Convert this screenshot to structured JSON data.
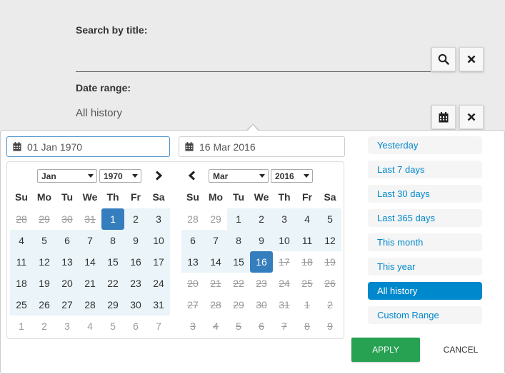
{
  "form": {
    "search_label": "Search by title:",
    "search_value": "",
    "date_label": "Date range:",
    "date_value": "All history"
  },
  "picker": {
    "start_input": "01 Jan 1970",
    "end_input": "16 Mar 2016",
    "left": {
      "month": "Jan",
      "year": "1970",
      "weeks": [
        [
          "28",
          "29",
          "30",
          "31",
          "1",
          "2",
          "3"
        ],
        [
          "4",
          "5",
          "6",
          "7",
          "8",
          "9",
          "10"
        ],
        [
          "11",
          "12",
          "13",
          "14",
          "15",
          "16",
          "17"
        ],
        [
          "18",
          "19",
          "20",
          "21",
          "22",
          "23",
          "24"
        ],
        [
          "25",
          "26",
          "27",
          "28",
          "29",
          "30",
          "31"
        ],
        [
          "1",
          "2",
          "3",
          "4",
          "5",
          "6",
          "7"
        ]
      ]
    },
    "right": {
      "month": "Mar",
      "year": "2016",
      "weeks": [
        [
          "28",
          "29",
          "1",
          "2",
          "3",
          "4",
          "5"
        ],
        [
          "6",
          "7",
          "8",
          "9",
          "10",
          "11",
          "12"
        ],
        [
          "13",
          "14",
          "15",
          "16",
          "17",
          "18",
          "19"
        ],
        [
          "20",
          "21",
          "22",
          "23",
          "24",
          "25",
          "26"
        ],
        [
          "27",
          "28",
          "29",
          "30",
          "31",
          "1",
          "2"
        ],
        [
          "3",
          "4",
          "5",
          "6",
          "7",
          "8",
          "9"
        ]
      ]
    },
    "weekdays": [
      "Su",
      "Mo",
      "Tu",
      "We",
      "Th",
      "Fr",
      "Sa"
    ],
    "ranges": [
      "Yesterday",
      "Last 7 days",
      "Last 30 days",
      "Last 365 days",
      "This month",
      "This year",
      "All history",
      "Custom Range"
    ],
    "active_range": "All history",
    "apply_label": "APPLY",
    "cancel_label": "CANCEL"
  },
  "colors": {
    "accent": "#0088cc",
    "selected_day": "#357ebd",
    "in_range": "#ebf4f8",
    "apply": "#27a152"
  }
}
